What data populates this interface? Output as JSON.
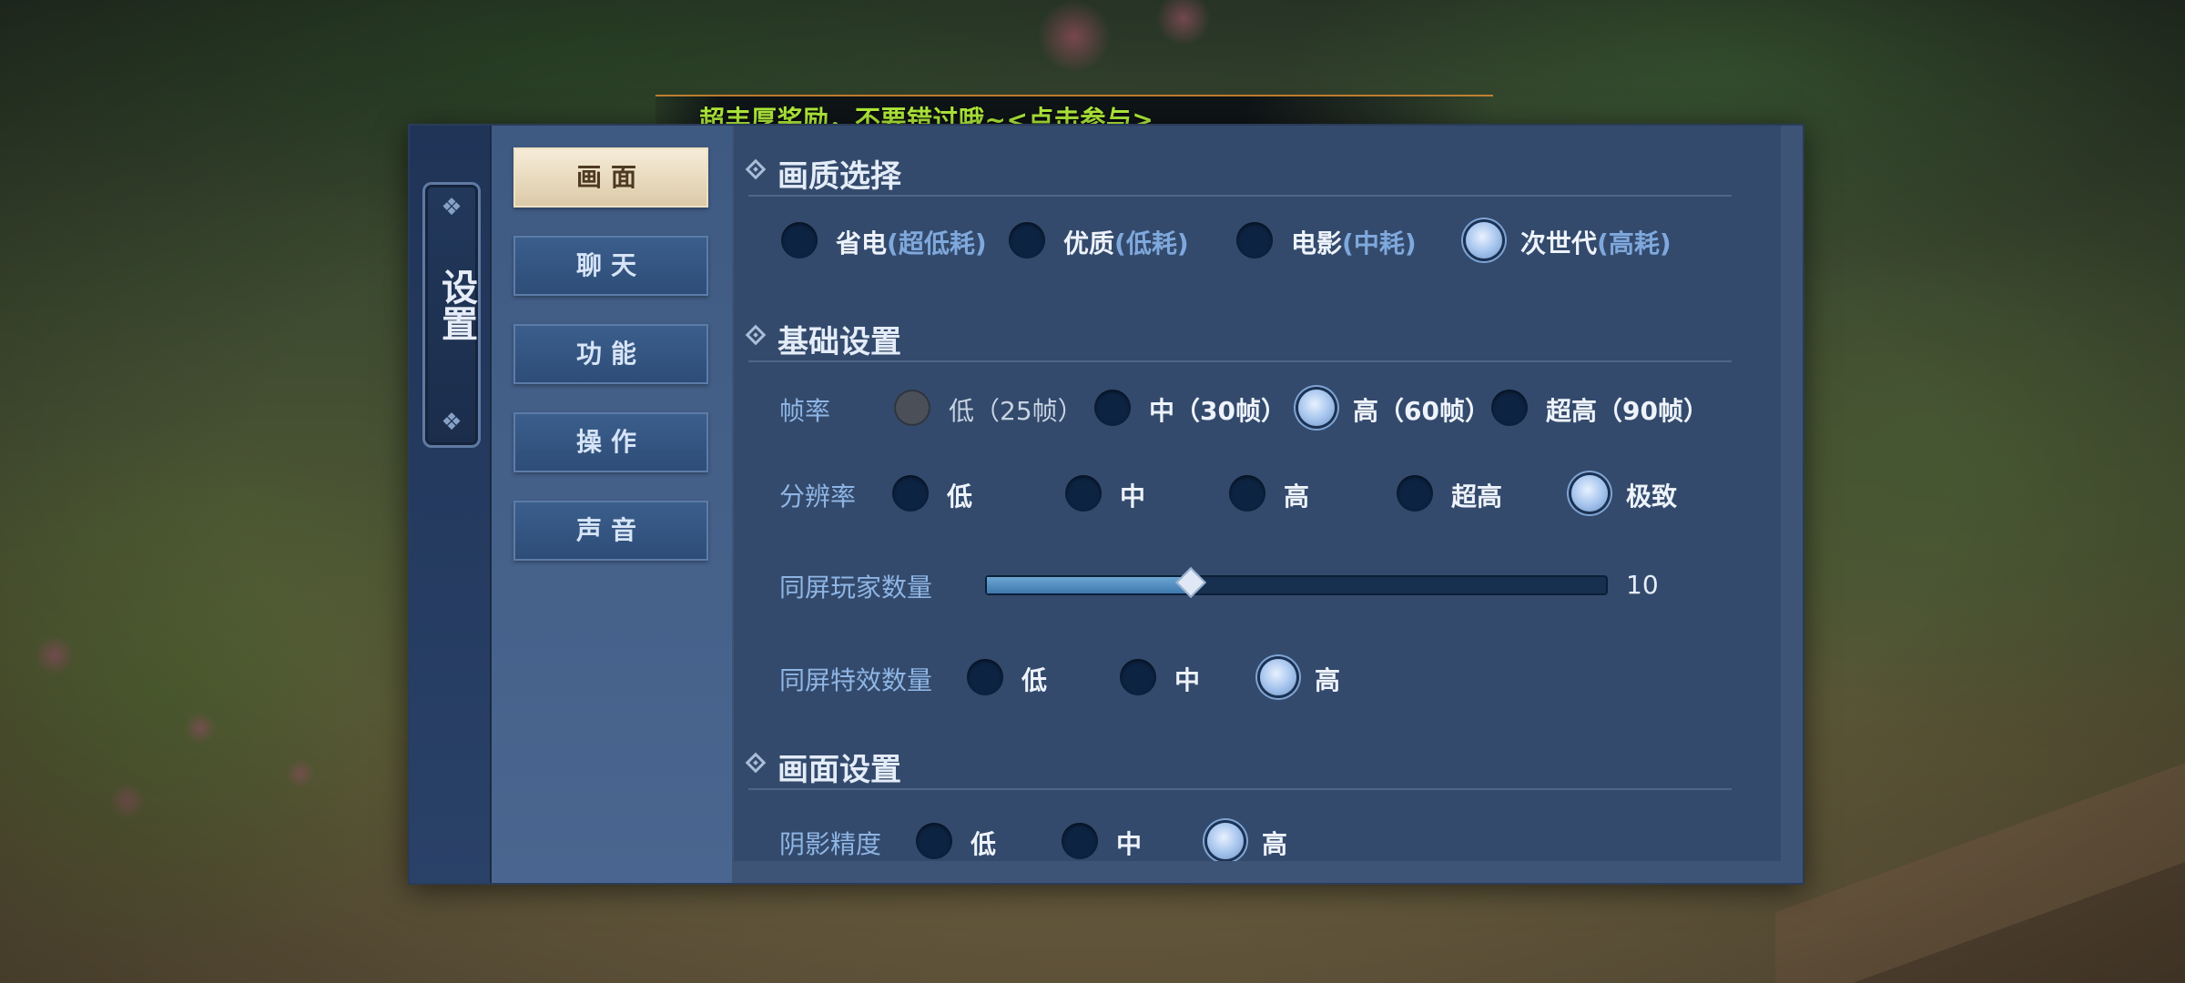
{
  "banner": {
    "text": "超丰厚奖励，不要错过哦~<点击参与>"
  },
  "panel": {
    "title": "设置"
  },
  "menu": [
    {
      "label": "画面",
      "active": true
    },
    {
      "label": "聊天",
      "active": false
    },
    {
      "label": "功能",
      "active": false
    },
    {
      "label": "操作",
      "active": false
    },
    {
      "label": "声音",
      "active": false
    }
  ],
  "quality": {
    "title": "画质选择",
    "options": [
      {
        "label": "省电",
        "sub": "(超低耗)",
        "selected": false
      },
      {
        "label": "优质",
        "sub": "(低耗)",
        "selected": false
      },
      {
        "label": "电影",
        "sub": "(中耗)",
        "selected": false
      },
      {
        "label": "次世代",
        "sub": "(高耗)",
        "selected": true
      }
    ]
  },
  "basic": {
    "title": "基础设置",
    "framerate": {
      "label": "帧率",
      "options": [
        {
          "label": "低（25帧）",
          "selected": false,
          "disabled": true
        },
        {
          "label": "中（30帧）",
          "selected": false
        },
        {
          "label": "高（60帧）",
          "selected": true
        },
        {
          "label": "超高（90帧）",
          "selected": false
        }
      ]
    },
    "resolution": {
      "label": "分辨率",
      "options": [
        {
          "label": "低",
          "selected": false
        },
        {
          "label": "中",
          "selected": false
        },
        {
          "label": "高",
          "selected": false
        },
        {
          "label": "超高",
          "selected": false
        },
        {
          "label": "极致",
          "selected": true
        }
      ]
    },
    "players": {
      "label": "同屏玩家数量",
      "value": "10",
      "fraction": 0.33
    },
    "effects": {
      "label": "同屏特效数量",
      "options": [
        {
          "label": "低",
          "selected": false
        },
        {
          "label": "中",
          "selected": false
        },
        {
          "label": "高",
          "selected": true
        }
      ]
    }
  },
  "display": {
    "title": "画面设置",
    "shadow": {
      "label": "阴影精度",
      "options": [
        {
          "label": "低",
          "selected": false
        },
        {
          "label": "中",
          "selected": false
        },
        {
          "label": "高",
          "selected": true
        }
      ]
    }
  },
  "colors": {
    "accent": "#b4f03c",
    "panel": "#3d5477",
    "active_tab": "#eadcc0",
    "label": "#8fb5e4"
  }
}
